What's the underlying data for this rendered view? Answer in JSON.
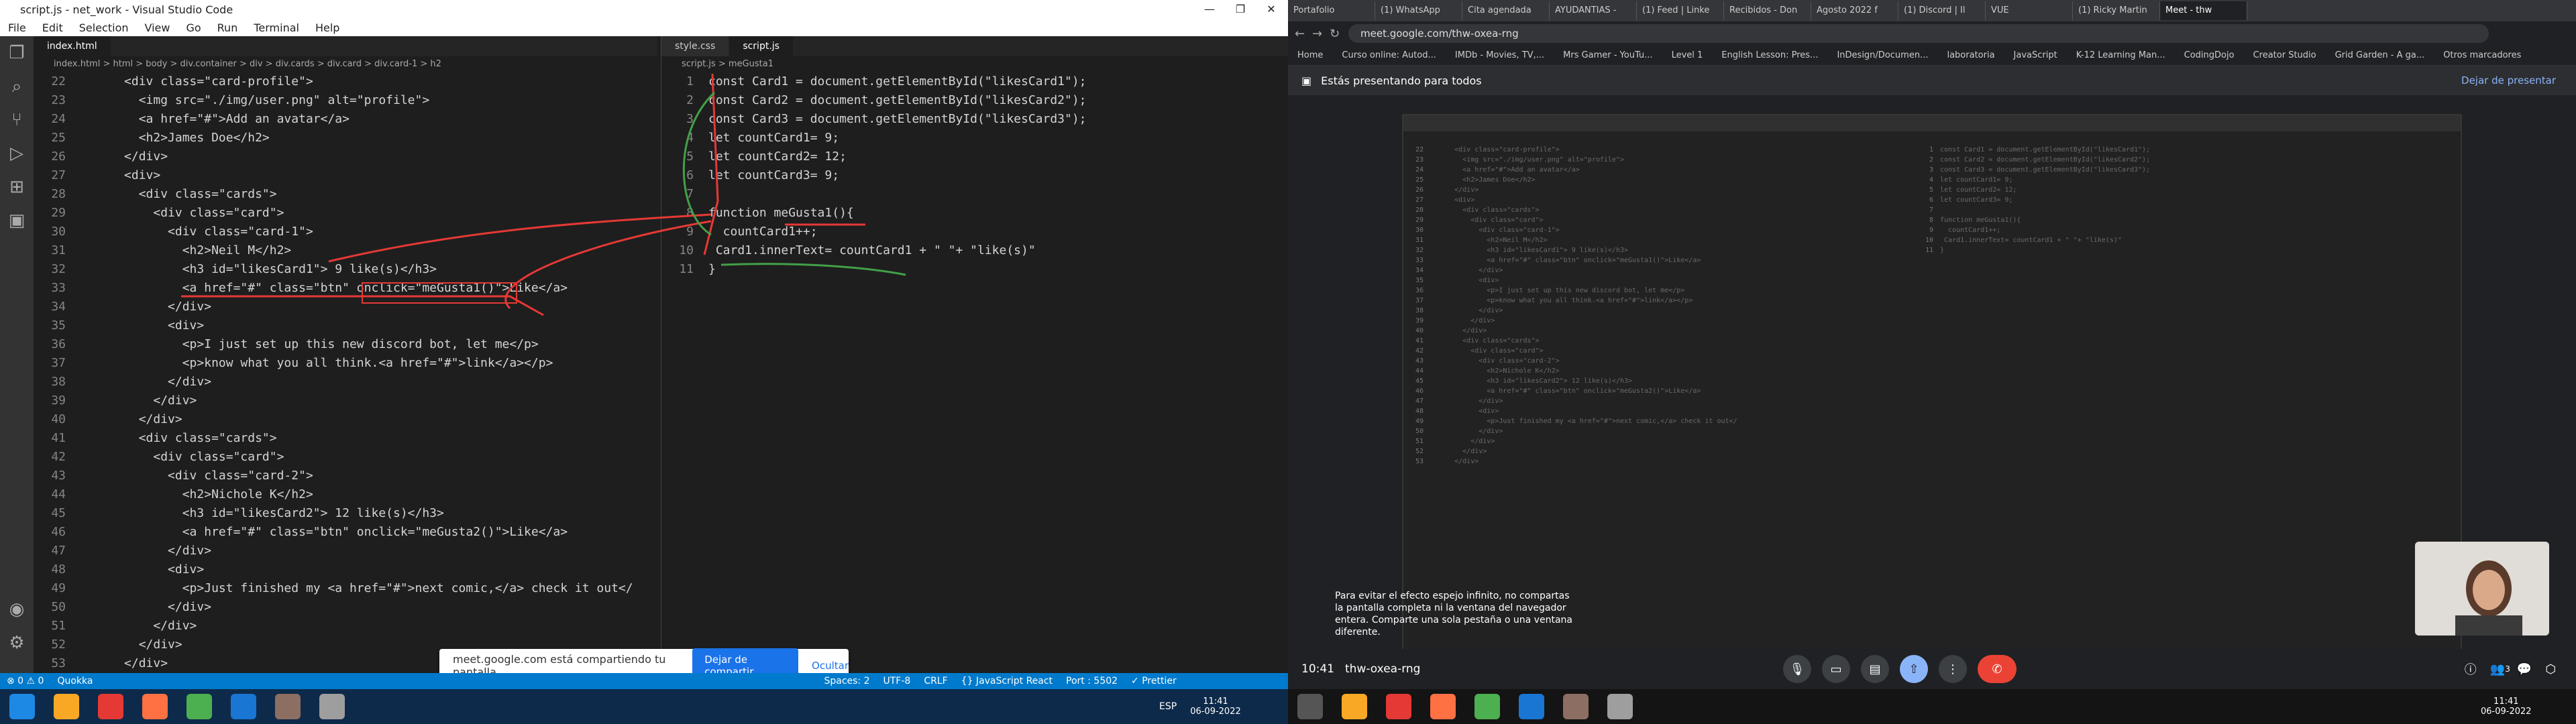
{
  "vscode": {
    "title": "script.js - net_work - Visual Studio Code",
    "menu": [
      "File",
      "Edit",
      "Selection",
      "View",
      "Go",
      "Run",
      "Terminal",
      "Help"
    ],
    "tabs_left": [
      "index.html"
    ],
    "tabs_right": [
      "style.css",
      "script.js"
    ],
    "bread_left": "index.html > html > body > div.container > div > div.cards > div.card > div.card-1 > h2",
    "bread_right": "script.js > meGusta1",
    "html_lines": [
      {
        "n": "22",
        "t": "      <div class=\"card-profile\">"
      },
      {
        "n": "23",
        "t": "        <img src=\"./img/user.png\" alt=\"profile\">"
      },
      {
        "n": "24",
        "t": "        <a href=\"#\">Add an avatar</a>"
      },
      {
        "n": "25",
        "t": "        <h2>James Doe</h2>"
      },
      {
        "n": "26",
        "t": "      </div>"
      },
      {
        "n": "27",
        "t": "      <div>"
      },
      {
        "n": "28",
        "t": "        <div class=\"cards\">"
      },
      {
        "n": "29",
        "t": "          <div class=\"card\">"
      },
      {
        "n": "30",
        "t": "            <div class=\"card-1\">"
      },
      {
        "n": "31",
        "t": "              <h2>Neil M</h2>"
      },
      {
        "n": "32",
        "t": "              <h3 id=\"likesCard1\"> 9 like(s)</h3>"
      },
      {
        "n": "33",
        "t": "              <a href=\"#\" class=\"btn\" onclick=\"meGusta1()\">Like</a>"
      },
      {
        "n": "34",
        "t": "            </div>"
      },
      {
        "n": "35",
        "t": "            <div>"
      },
      {
        "n": "36",
        "t": "              <p>I just set up this new discord bot, let me</p>"
      },
      {
        "n": "37",
        "t": "              <p>know what you all think.<a href=\"#\">link</a></p>"
      },
      {
        "n": "38",
        "t": "            </div>"
      },
      {
        "n": "39",
        "t": "          </div>"
      },
      {
        "n": "40",
        "t": "        </div>"
      },
      {
        "n": "41",
        "t": "        <div class=\"cards\">"
      },
      {
        "n": "42",
        "t": "          <div class=\"card\">"
      },
      {
        "n": "43",
        "t": "            <div class=\"card-2\">"
      },
      {
        "n": "44",
        "t": "              <h2>Nichole K</h2>"
      },
      {
        "n": "45",
        "t": "              <h3 id=\"likesCard2\"> 12 like(s)</h3>"
      },
      {
        "n": "46",
        "t": "              <a href=\"#\" class=\"btn\" onclick=\"meGusta2()\">Like</a>"
      },
      {
        "n": "47",
        "t": "            </div>"
      },
      {
        "n": "48",
        "t": "            <div>"
      },
      {
        "n": "49",
        "t": "              <p>Just finished my <a href=\"#\">next comic,</a> check it out</"
      },
      {
        "n": "50",
        "t": "            </div>"
      },
      {
        "n": "51",
        "t": "          </div>"
      },
      {
        "n": "52",
        "t": "        </div>"
      },
      {
        "n": "53",
        "t": "      </div>"
      }
    ],
    "js_lines": [
      {
        "n": "1",
        "t": "const Card1 = document.getElementById(\"likesCard1\");"
      },
      {
        "n": "2",
        "t": "const Card2 = document.getElementById(\"likesCard2\");"
      },
      {
        "n": "3",
        "t": "const Card3 = document.getElementById(\"likesCard3\");"
      },
      {
        "n": "4",
        "t": "let countCard1= 9;"
      },
      {
        "n": "5",
        "t": "let countCard2= 12;"
      },
      {
        "n": "6",
        "t": "let countCard3= 9;"
      },
      {
        "n": "7",
        "t": ""
      },
      {
        "n": "8",
        "t": "function meGusta1(){"
      },
      {
        "n": "9",
        "t": "  countCard1++;"
      },
      {
        "n": "10",
        "t": " Card1.innerText= countCard1 + \" \"+ \"like(s)\""
      },
      {
        "n": "11",
        "t": "}"
      }
    ],
    "status": [
      "⊗ 0 ⚠ 0",
      "Quokka",
      "Spaces: 2",
      "UTF-8",
      "CRLF",
      "{} JavaScript React",
      "Port : 5502",
      "✓ Prettier"
    ],
    "share_msg": "meet.google.com está compartiendo tu pantalla.",
    "share_stop": "Dejar de compartir",
    "share_hide": "Ocultar",
    "tray_lang": "ESP",
    "tray_time": "11:41",
    "tray_date": "06-09-2022"
  },
  "chrome": {
    "tabs": [
      "Portafolio",
      "(1) WhatsApp",
      "Cita agendada",
      "AYUDANTIAS -",
      "(1) Feed | Linke",
      "Recibidos - Don",
      "Agosto 2022 f",
      "(1) Discord | Il",
      "VUE",
      "(1) Ricky Martin",
      "Meet - thw"
    ],
    "url": "meet.google.com/thw-oxea-rng",
    "bookmarks": [
      "Home",
      "Curso online: Autod...",
      "IMDb - Movies, TV,...",
      "Mrs Gamer - YouTu...",
      "Level 1",
      "English Lesson: Pres...",
      "InDesign/Documen...",
      "laboratoria",
      "JavaScript",
      "K-12 Learning Man...",
      "CodingDojo",
      "Creator Studio",
      "Grid Garden - A ga...",
      "Otros marcadores"
    ],
    "present_text": "Estás presentando para todos",
    "present_stop": "Dejar de presentar",
    "warn_text": "Para evitar el efecto espejo infinito, no compartas la pantalla completa ni la ventana del navegador entera. Comparte una sola pestaña o una ventana diferente.",
    "meeting_time": "10:41",
    "meeting_code": "thw-oxea-rng",
    "participants": "3",
    "tray_time": "11:41",
    "tray_date": "06-09-2022"
  }
}
